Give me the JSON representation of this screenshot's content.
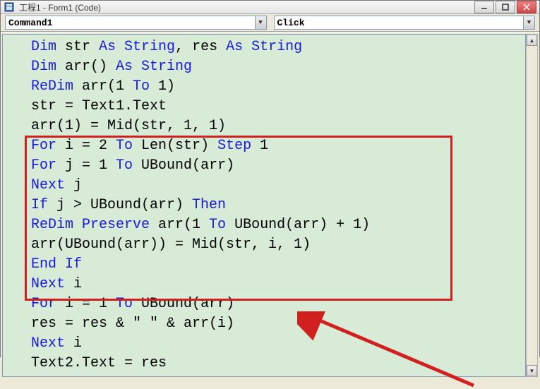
{
  "window": {
    "title": "工程1 - Form1 (Code)"
  },
  "dropdowns": {
    "object": "Command1",
    "event": "Click"
  },
  "code": {
    "lines": [
      [
        {
          "t": "Dim ",
          "c": "kw"
        },
        {
          "t": "str "
        },
        {
          "t": "As String",
          "c": "kw"
        },
        {
          "t": ", res "
        },
        {
          "t": "As String",
          "c": "kw"
        }
      ],
      [
        {
          "t": "Dim ",
          "c": "kw"
        },
        {
          "t": "arr() "
        },
        {
          "t": "As String",
          "c": "kw"
        }
      ],
      [
        {
          "t": "ReDim ",
          "c": "kw"
        },
        {
          "t": "arr(1 "
        },
        {
          "t": "To",
          "c": "kw"
        },
        {
          "t": " 1)"
        }
      ],
      [
        {
          "t": "str = Text1.Text"
        }
      ],
      [
        {
          "t": "arr(1) = Mid(str, 1, 1)"
        }
      ],
      [
        {
          "t": "For ",
          "c": "kw"
        },
        {
          "t": "i = 2 "
        },
        {
          "t": "To",
          "c": "kw"
        },
        {
          "t": " Len(str) "
        },
        {
          "t": "Step",
          "c": "kw"
        },
        {
          "t": " 1"
        }
      ],
      [
        {
          "t": "For ",
          "c": "kw"
        },
        {
          "t": "j = 1 "
        },
        {
          "t": "To",
          "c": "kw"
        },
        {
          "t": " UBound(arr)"
        }
      ],
      [
        {
          "t": "Next ",
          "c": "kw"
        },
        {
          "t": "j"
        }
      ],
      [
        {
          "t": "If ",
          "c": "kw"
        },
        {
          "t": "j > UBound(arr) "
        },
        {
          "t": "Then",
          "c": "kw"
        }
      ],
      [
        {
          "t": "ReDim Preserve ",
          "c": "kw"
        },
        {
          "t": "arr(1 "
        },
        {
          "t": "To",
          "c": "kw"
        },
        {
          "t": " UBound(arr) + 1)"
        }
      ],
      [
        {
          "t": "arr(UBound(arr)) = Mid(str, i, 1)"
        }
      ],
      [
        {
          "t": "End If",
          "c": "kw"
        }
      ],
      [
        {
          "t": "Next ",
          "c": "kw"
        },
        {
          "t": "i"
        }
      ],
      [
        {
          "t": "For ",
          "c": "kw"
        },
        {
          "t": "i = 1 "
        },
        {
          "t": "To",
          "c": "kw"
        },
        {
          "t": " UBound(arr)"
        }
      ],
      [
        {
          "t": "res = res & \" \" & arr(i)"
        }
      ],
      [
        {
          "t": "Next ",
          "c": "kw"
        },
        {
          "t": "i"
        }
      ],
      [
        {
          "t": "Text2.Text = res"
        }
      ]
    ]
  },
  "annotations": {
    "arrow_color": "#d02020"
  }
}
